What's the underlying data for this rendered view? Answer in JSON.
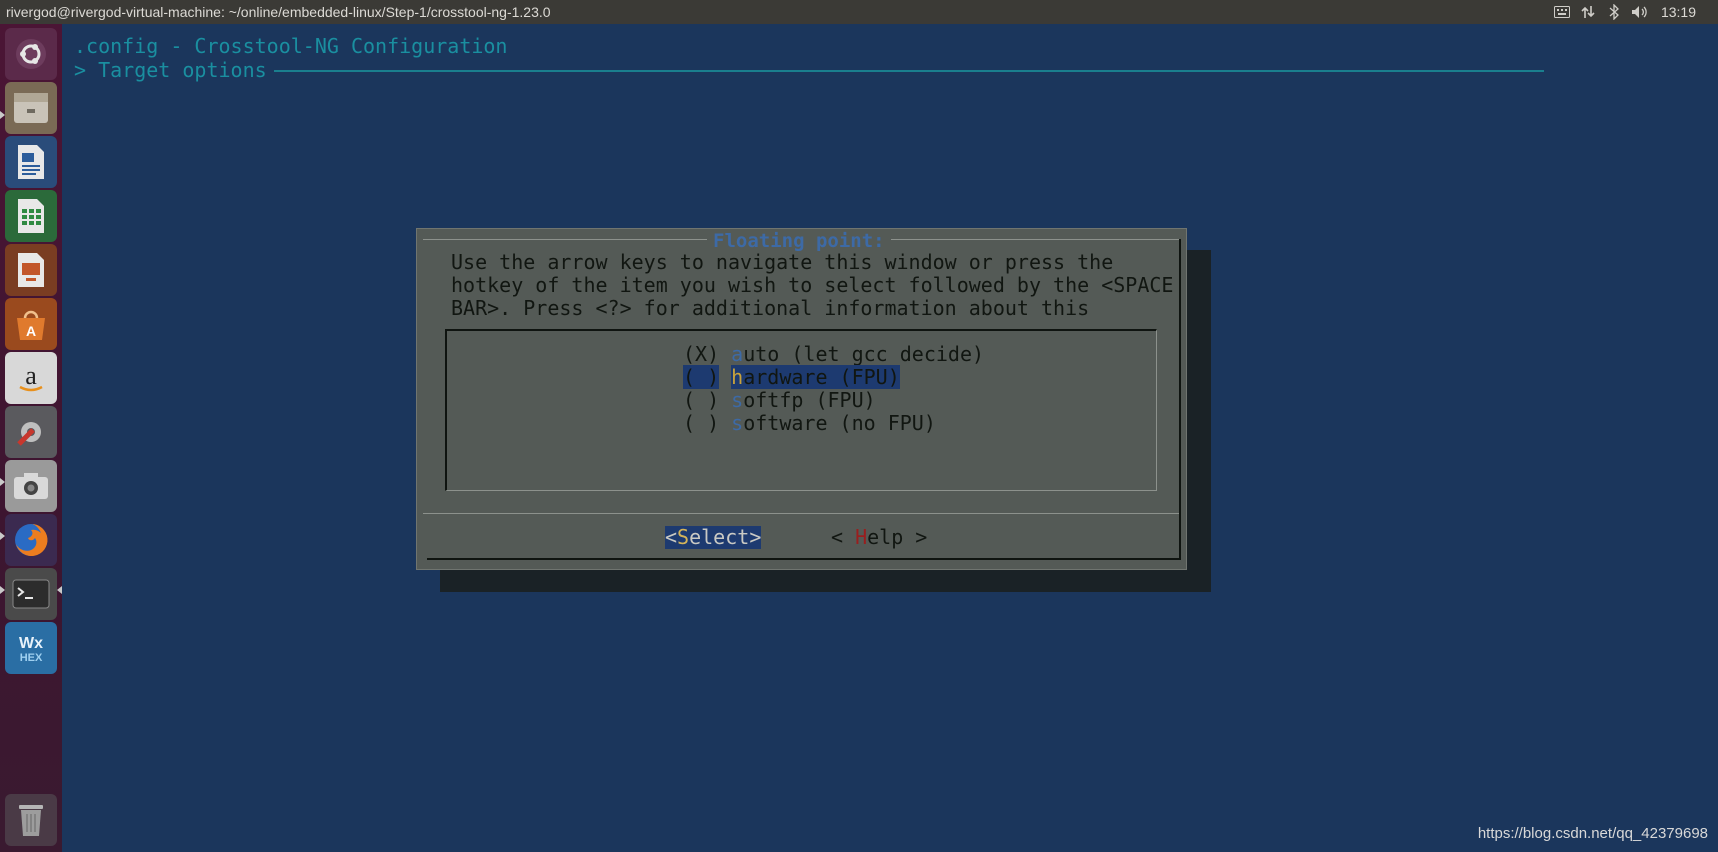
{
  "window_title": "rivergod@rivergod-virtual-machine: ~/online/embedded-linux/Step-1/crosstool-ng-1.23.0",
  "clock": "13:19",
  "tray_icons": [
    "keyboard-icon",
    "network-icon",
    "bluetooth-icon",
    "volume-icon"
  ],
  "launcher": [
    "ubuntu-dash-icon",
    "files-icon",
    "writer-icon",
    "calc-icon",
    "impress-icon",
    "software-center-icon",
    "amazon-icon",
    "system-settings-icon",
    "camera-icon",
    "firefox-icon",
    "terminal-icon",
    "wxhex-icon",
    "trash-icon"
  ],
  "terminal": {
    "header": ".config - Crosstool-NG Configuration",
    "breadcrumb": "> Target options"
  },
  "dialog": {
    "title": "Floating point:",
    "prompt_lines": [
      "Use the arrow keys to navigate this window or press the",
      "hotkey of the item you wish to select followed by the <SPACE",
      "BAR>. Press <?> for additional information about this"
    ],
    "options": [
      {
        "mark": "(X)",
        "hotkey": "a",
        "rest": "uto (let gcc decide)",
        "highlighted": false
      },
      {
        "mark": "( )",
        "hotkey": "h",
        "rest": "ardware (FPU)",
        "highlighted": true
      },
      {
        "mark": "( )",
        "hotkey": "s",
        "rest": "oftfp (FPU)",
        "highlighted": false
      },
      {
        "mark": "( )",
        "hotkey": "s",
        "rest": "oftware (no FPU)",
        "highlighted": false
      }
    ],
    "buttons": {
      "select": {
        "open": "<",
        "hotkey": "S",
        "rest": "elect",
        "close": ">"
      },
      "help": {
        "open": "< ",
        "hotkey": "H",
        "rest": "elp",
        "close": " >"
      }
    }
  },
  "watermark": "https://blog.csdn.net/qq_42379698",
  "colors": {
    "terminal_bg": "#1b365c",
    "header_text": "#1a8fa0",
    "dialog_bg": "#545a56",
    "highlight": "#1d3a70",
    "hotkey": "#3d6aa6",
    "help_hotkey": "#9a1e1e"
  }
}
